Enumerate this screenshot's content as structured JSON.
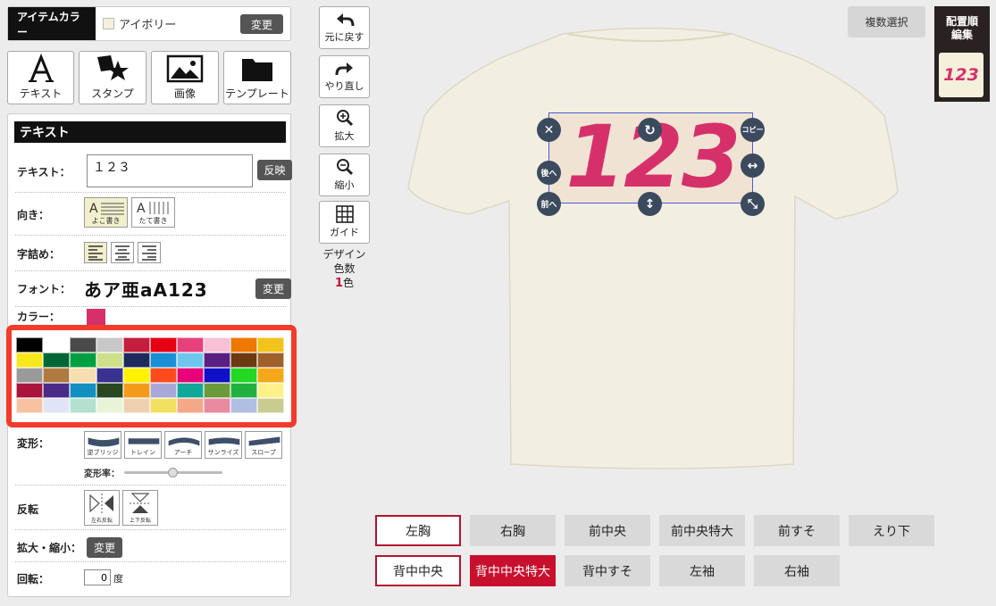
{
  "item_color": {
    "label": "アイテムカラー",
    "value": "アイボリー",
    "change": "変更"
  },
  "tools": [
    {
      "label": "テキスト",
      "icon": "text-icon"
    },
    {
      "label": "スタンプ",
      "icon": "stamp-icon"
    },
    {
      "label": "画像",
      "icon": "image-icon"
    },
    {
      "label": "テンプレート",
      "icon": "folder-icon"
    }
  ],
  "text_panel": {
    "header": "テキスト",
    "text_label": "テキスト：",
    "text_value": "１２３",
    "apply": "反映",
    "orientation_label": "向き：",
    "orientation_options": [
      "よこ書き",
      "たて書き"
    ],
    "align_label": "字詰め：",
    "font_label": "フォント：",
    "font_sample": "あア亜aA123",
    "font_change": "変更",
    "color_label": "カラー：",
    "deform_label": "変形：",
    "deform_options": [
      "逆ブリッジ",
      "トレイン",
      "アーチ",
      "サンライズ",
      "スロープ"
    ],
    "deform_rate_label": "変形率：",
    "deform_rate": 0.5,
    "flip_label": "反転",
    "flip_options": [
      "左右反転",
      "上下反転"
    ],
    "scale_label": "拡大・縮小：",
    "scale_change": "変更",
    "rotate_label": "回転：",
    "rotate_value": "0",
    "rotate_unit": "度"
  },
  "palette": [
    "#000000",
    "#ffffff",
    "#4a4a4a",
    "#c8c8c8",
    "#c41e3a",
    "#e60012",
    "#e8407a",
    "#f7c0d4",
    "#ee7800",
    "#f2c31a",
    "#f8e71c",
    "#006633",
    "#00a040",
    "#cfe08a",
    "#1f2a5c",
    "#1a8fd6",
    "#6ec6ee",
    "#5a1f82",
    "#6b3a10",
    "#a0602a",
    "#9a9a9a",
    "#b07a40",
    "#f6deb0",
    "#3a3290",
    "#fff200",
    "#ff4a1c",
    "#e8007a",
    "#1010c8",
    "#22d822",
    "#f4a81a",
    "#a8143c",
    "#4b2a88",
    "#1290c0",
    "#284820",
    "#f49a1a",
    "#a8a8d8",
    "#10a898",
    "#6a9a3a",
    "#20b040",
    "#fff08a",
    "#f7c2a2",
    "#e0e4f6",
    "#b4e0d0",
    "#e8f4d8",
    "#eed0b0",
    "#f2e060",
    "#f4a888",
    "#ea8aa0",
    "#b0bee4",
    "#c8cc90"
  ],
  "toolbar": [
    {
      "label": "元に戻す",
      "icon": "undo-icon"
    },
    {
      "label": "やり直し",
      "icon": "redo-icon"
    },
    {
      "label": "拡大",
      "icon": "zoom-in-icon"
    },
    {
      "label": "縮小",
      "icon": "zoom-out-icon"
    },
    {
      "label": "ガイド",
      "icon": "grid-icon"
    }
  ],
  "design_colors": {
    "line1": "デザイン",
    "line2": "色数",
    "count": "1",
    "unit": "色"
  },
  "multi_select": "複数選択",
  "order_edit": {
    "line1": "配置順",
    "line2": "編集",
    "thumb": "123"
  },
  "design_text": "123",
  "design_color": "#d6306b",
  "shirt_color": "#f2efe2",
  "handles": {
    "copy": "コピー",
    "back": "後へ",
    "front": "前へ"
  },
  "positions_row1": [
    "左胸",
    "右胸",
    "前中央",
    "前中央特大",
    "前すそ",
    "えり下"
  ],
  "positions_row2": [
    "背中中央",
    "背中中央特大",
    "背中すそ",
    "左袖",
    "右袖"
  ],
  "accent": "#c8102e",
  "highlight": "#f23b2b"
}
